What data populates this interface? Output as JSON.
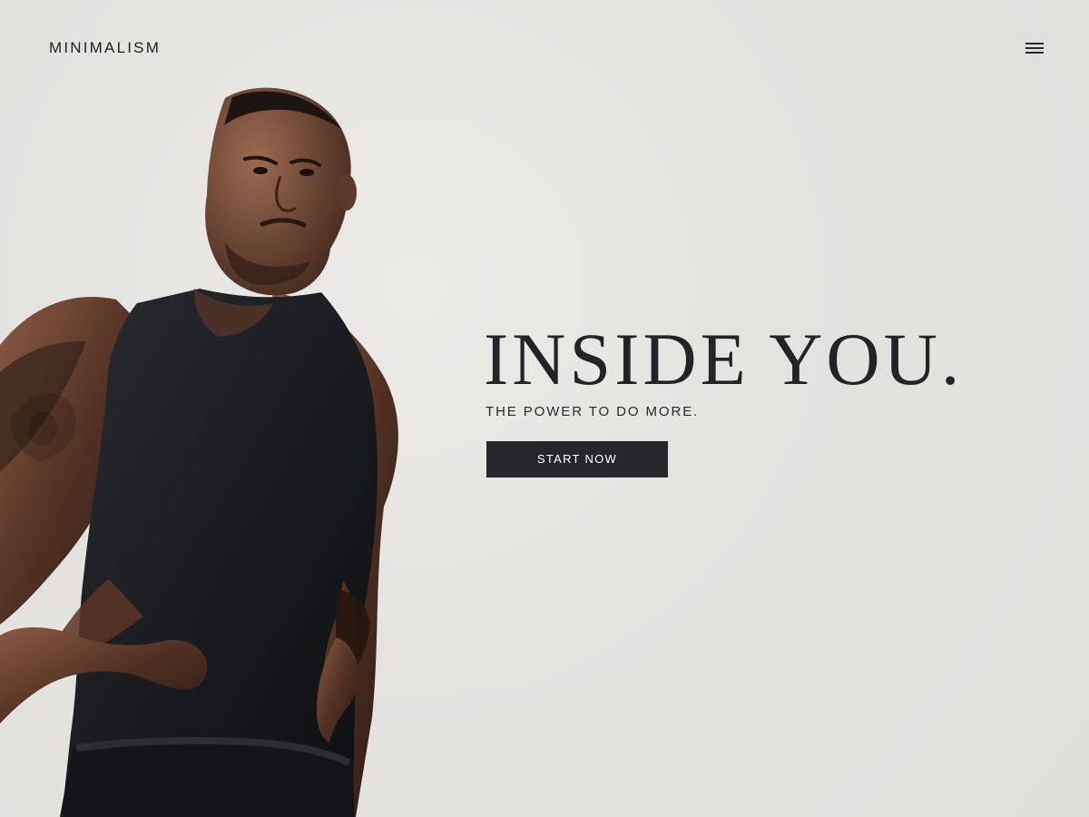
{
  "header": {
    "brand": "MINIMALISM",
    "menu_icon": "hamburger-menu-icon"
  },
  "hero": {
    "headline": "INSIDE YOU.",
    "subheadline": "THE POWER TO DO MORE.",
    "cta_label": "START NOW"
  },
  "colors": {
    "background": "#e4e2df",
    "text": "#242428",
    "button": "#27272b",
    "button_text": "#ffffff"
  }
}
